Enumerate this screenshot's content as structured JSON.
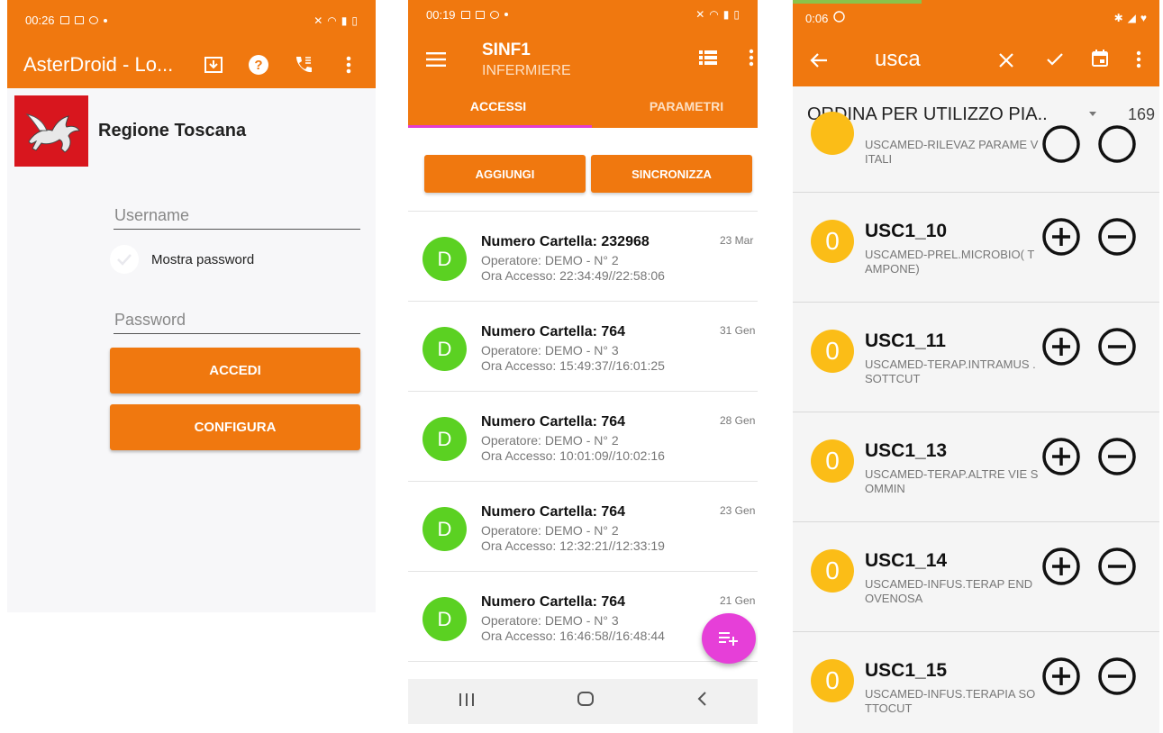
{
  "screen1": {
    "status_time": "00:26",
    "app_title": "AsterDroid - Lo...",
    "region": "Regione Toscana",
    "username_placeholder": "Username",
    "show_password": "Mostra password",
    "password_placeholder": "Password",
    "login_button": "ACCEDI",
    "configure_button": "CONFIGURA",
    "icons": [
      "download-icon",
      "help-icon",
      "phone-call-icon",
      "more-vert-icon"
    ]
  },
  "screen2": {
    "status_time": "00:19",
    "title": "SINF1",
    "subtitle": "INFERMIERE",
    "tabs": [
      "ACCESSI",
      "PARAMETRI"
    ],
    "add_button": "AGGIUNGI",
    "sync_button": "SINCRONIZZA",
    "rows": [
      {
        "avatar": "D",
        "title": "Numero Cartella: 232968",
        "operator": "Operatore: DEMO - N° 2",
        "access": "Ora Accesso: 22:34:49//22:58:06",
        "date": "23 Mar"
      },
      {
        "avatar": "D",
        "title": "Numero Cartella: 764",
        "operator": "Operatore: DEMO - N° 3",
        "access": "Ora Accesso: 15:49:37//16:01:25",
        "date": "31 Gen"
      },
      {
        "avatar": "D",
        "title": "Numero Cartella: 764",
        "operator": "Operatore: DEMO - N° 2",
        "access": "Ora Accesso: 10:01:09//10:02:16",
        "date": "28 Gen"
      },
      {
        "avatar": "D",
        "title": "Numero Cartella: 764",
        "operator": "Operatore: DEMO - N° 2",
        "access": "Ora Accesso: 12:32:21//12:33:19",
        "date": "23 Gen"
      },
      {
        "avatar": "D",
        "title": "Numero Cartella: 764",
        "operator": "Operatore: DEMO - N° 3",
        "access": "Ora Accesso: 16:46:58//16:48:44",
        "date": "21 Gen"
      }
    ]
  },
  "screen3": {
    "status_time": "0:06",
    "search_query": "usca",
    "sort_label": "ORDINA PER UTILIZZO PIA..",
    "count": "169",
    "partial_item_desc": "USCAMED-RILEVAZ PARAME VITALI",
    "items": [
      {
        "qty": "0",
        "code": "USC1_10",
        "desc": "USCAMED-PREL.MICROBIO( TAMPONE)"
      },
      {
        "qty": "0",
        "code": "USC1_11",
        "desc": "USCAMED-TERAP.INTRAMUS .SOTTCUT"
      },
      {
        "qty": "0",
        "code": "USC1_13",
        "desc": "USCAMED-TERAP.ALTRE VIE SOMMIN"
      },
      {
        "qty": "0",
        "code": "USC1_14",
        "desc": "USCAMED-INFUS.TERAP ENDOVENOSA"
      },
      {
        "qty": "0",
        "code": "USC1_15",
        "desc": "USCAMED-INFUS.TERAPIA SOTTOCUT"
      }
    ]
  }
}
